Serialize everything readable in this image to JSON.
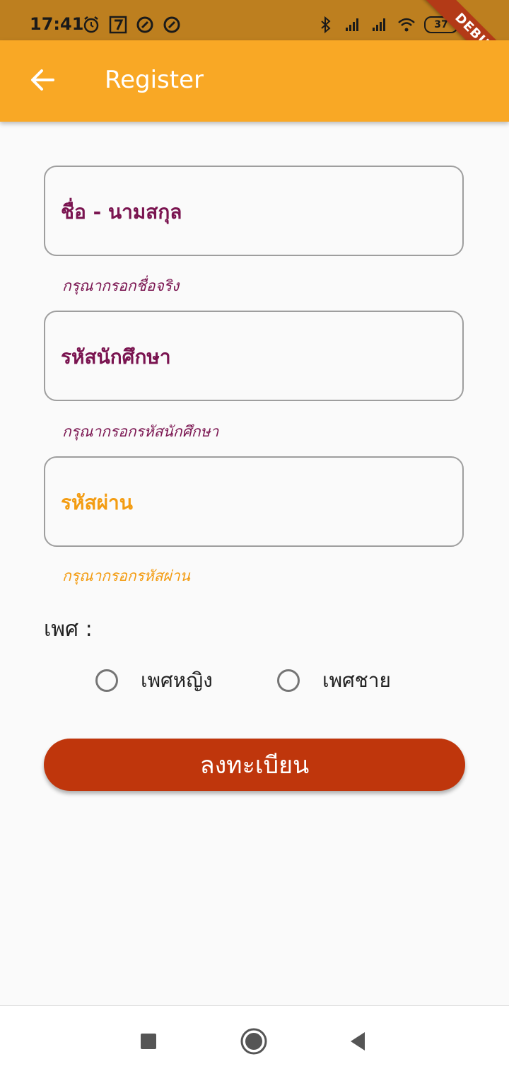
{
  "status_bar": {
    "time": "17:41",
    "battery": "37",
    "icons_left": [
      "alarm-icon",
      "seven-eleven-icon",
      "app-icon",
      "app-icon"
    ],
    "icons_right": [
      "bluetooth-icon",
      "signal-icon",
      "signal-icon",
      "wifi-icon",
      "battery-icon"
    ]
  },
  "debug_banner": "DEBUG",
  "app_bar": {
    "title": "Register",
    "back_icon": "arrow-back-icon",
    "color": "#f9a825"
  },
  "form": {
    "name_field": {
      "label": "ชื่อ - นามสกุล",
      "helper": "กรุณากรอกชื่อจริง",
      "color": "#7a1450"
    },
    "student_id_field": {
      "label": "รหัสนักศึกษา",
      "helper": "กรุณากรอกรหัสนักศึกษา",
      "color": "#7a1450"
    },
    "password_field": {
      "label": "รหัสผ่าน",
      "helper": "กรุณากรอกรหัสผ่าน",
      "color": "#f39c12"
    },
    "gender": {
      "label": "เพศ :",
      "options": [
        "เพศหญิง",
        "เพศชาย"
      ]
    },
    "submit_label": "ลงทะเบียน",
    "submit_color": "#bf360c"
  },
  "nav_bar": {
    "icons": [
      "recent-apps-icon",
      "home-icon",
      "back-icon"
    ]
  }
}
